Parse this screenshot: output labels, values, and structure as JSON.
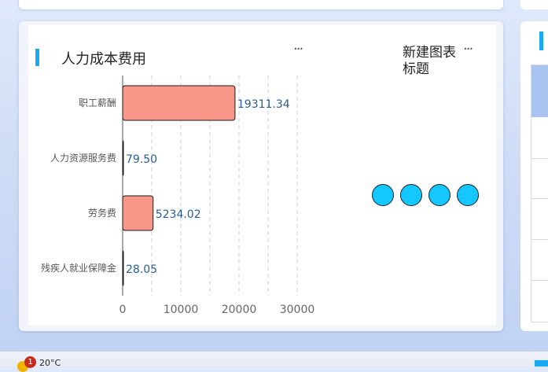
{
  "card": {
    "title": "人力成本费用",
    "more_label": "···"
  },
  "card2": {
    "title": "新建图表标题",
    "more_label": "···",
    "indicator_count": 4
  },
  "chart_data": {
    "type": "bar",
    "orientation": "horizontal",
    "categories": [
      "职工薪酬",
      "人力资源服务费",
      "劳务费",
      "残疾人就业保障金"
    ],
    "values": [
      19311.34,
      79.5,
      5234.02,
      28.05
    ],
    "value_labels": [
      "19311.34",
      "79.50",
      "5234.02",
      "28.05"
    ],
    "x_ticks": [
      0,
      10000,
      20000,
      30000
    ],
    "xlim": [
      0,
      30000
    ],
    "grid": "dashed vertical",
    "bar_color": "#f8968a"
  },
  "taskbar": {
    "badge": "1",
    "temperature": "20°C"
  }
}
